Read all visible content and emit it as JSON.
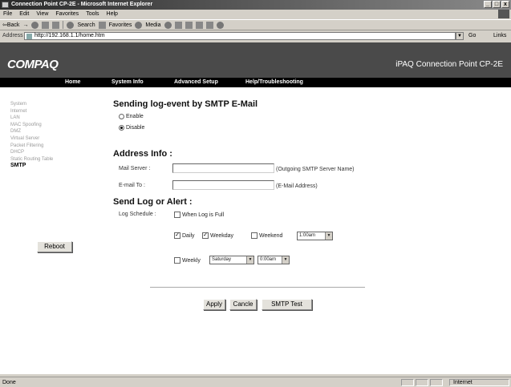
{
  "window": {
    "title": "Connection Point CP-2E  - Microsoft Internet Explorer",
    "controls": [
      "_",
      "□",
      "x"
    ]
  },
  "menu": [
    "File",
    "Edit",
    "View",
    "Favorites",
    "Tools",
    "Help"
  ],
  "toolbar": {
    "back": "⇦Back",
    "forward": "→",
    "search": "Search",
    "favorites": "Favorites",
    "media": "Media"
  },
  "address": {
    "label": "Address",
    "url": "http://192.168.1.1/home.htm",
    "go": "Go",
    "links": "Links"
  },
  "brand": {
    "logo": "COMPAQ",
    "product": "iPAQ Connection Point CP-2E"
  },
  "nav": {
    "home": "Home",
    "system_info": "System Info",
    "advanced_setup": "Advanced Setup",
    "help": "Help/Troubleshooting"
  },
  "sidebar": {
    "items": [
      "System",
      "Internet",
      "LAN",
      "MAC Spoofing",
      "DMZ",
      "Virtual Server",
      "Packet Filtering",
      "DHCP",
      "Static Routing Table",
      "SMTP"
    ],
    "reboot": "Reboot"
  },
  "smtp": {
    "heading": "Sending log-event by SMTP E-Mail",
    "enable": "Enable",
    "disable": "Disable",
    "selected": "Disable"
  },
  "address_info": {
    "heading": "Address Info :",
    "mail_server_label": "Mail Server :",
    "mail_server_value": "",
    "mail_server_note": "(Outgoing SMTP Server Name)",
    "email_label": "E-mail To :",
    "email_value": "",
    "email_note": "(E-Mail Address)"
  },
  "send_log": {
    "heading": "Send Log or Alert :",
    "schedule_label": "Log Schedule :",
    "when_full": "When Log is Full",
    "when_full_checked": false,
    "daily": "Daily",
    "daily_checked": true,
    "weekday": "Weekday",
    "weekday_checked": true,
    "weekend": "Weekend",
    "weekend_checked": false,
    "daily_time": "1:00am",
    "weekly": "Weekly",
    "weekly_checked": false,
    "weekly_day": "Saturday",
    "weekly_time": "0:00am"
  },
  "actions": {
    "apply": "Apply",
    "cancel": "Cancle",
    "test": "SMTP Test"
  },
  "status": {
    "text": "Done",
    "zone": "Internet"
  }
}
